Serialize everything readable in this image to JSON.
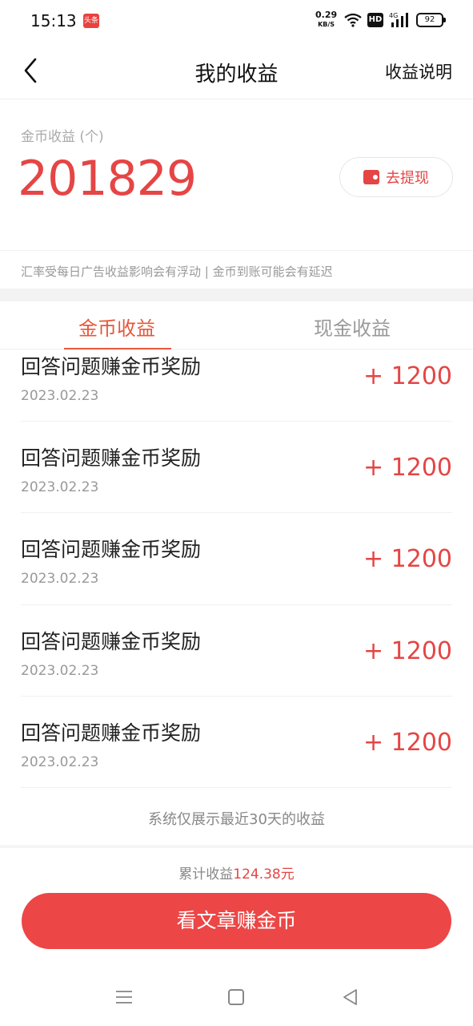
{
  "status_bar": {
    "time": "15:13",
    "app_badge": "头条",
    "net_speed_value": "0.29",
    "net_speed_unit": "KB/S",
    "hd": "HD",
    "network": "4G",
    "battery": "92"
  },
  "header": {
    "title": "我的收益",
    "help": "收益说明"
  },
  "balance": {
    "label": "金币收益 (个)",
    "value": "201829",
    "withdraw_label": "去提现"
  },
  "notice": "汇率受每日广告收益影响会有浮动 | 金币到账可能会有延迟",
  "tabs": [
    {
      "label": "金币收益",
      "active": true
    },
    {
      "label": "现金收益",
      "active": false
    }
  ],
  "records": [
    {
      "title": "回答问题赚金币奖励",
      "date": "2023.02.23",
      "amount": "+ 1200"
    },
    {
      "title": "回答问题赚金币奖励",
      "date": "2023.02.23",
      "amount": "+ 1200"
    },
    {
      "title": "回答问题赚金币奖励",
      "date": "2023.02.23",
      "amount": "+ 1200"
    },
    {
      "title": "回答问题赚金币奖励",
      "date": "2023.02.23",
      "amount": "+ 1200"
    },
    {
      "title": "回答问题赚金币奖励",
      "date": "2023.02.23",
      "amount": "+ 1200"
    }
  ],
  "footnote": "系统仅展示最近30天的收益",
  "total": {
    "label": "累计收益",
    "amount": "124.38元"
  },
  "cta": "看文章赚金币",
  "colors": {
    "accent": "#e54545",
    "tab_active": "#e5583b",
    "cta_background": "#ec4646"
  }
}
